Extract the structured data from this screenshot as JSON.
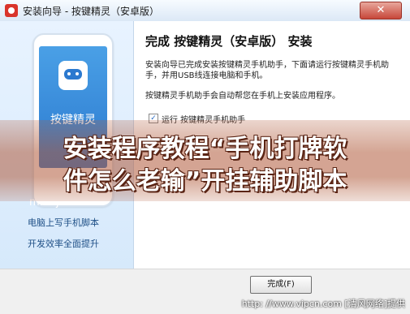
{
  "window": {
    "title": "安装向导 - 按键精灵（安卓版）",
    "close_symbol": "✕"
  },
  "left_panel": {
    "phone_label": "按键精灵",
    "url": "m.anjian.com",
    "slogan_1": "电脑上写手机脚本",
    "slogan_2": "开发效率全面提升"
  },
  "content": {
    "heading": "完成 按键精灵（安卓版） 安装",
    "para_1": "安装向导已完成安装按键精灵手机助手，下面请运行按键精灵手机助手，并用USB线连接电脑和手机。",
    "para_2": "按键精灵手机助手会自动帮您在手机上安装应用程序。",
    "checkbox_mark": "✓",
    "checkbox_label": "运行 按键精灵手机助手"
  },
  "footer": {
    "finish_button": "完成(F)",
    "watermark": "http: //www.vipcn.com [清风网络]提供"
  },
  "overlay": {
    "line_1": "安装程序教程“手机打牌软",
    "line_2": "件怎么老输”开挂辅助脚本"
  }
}
